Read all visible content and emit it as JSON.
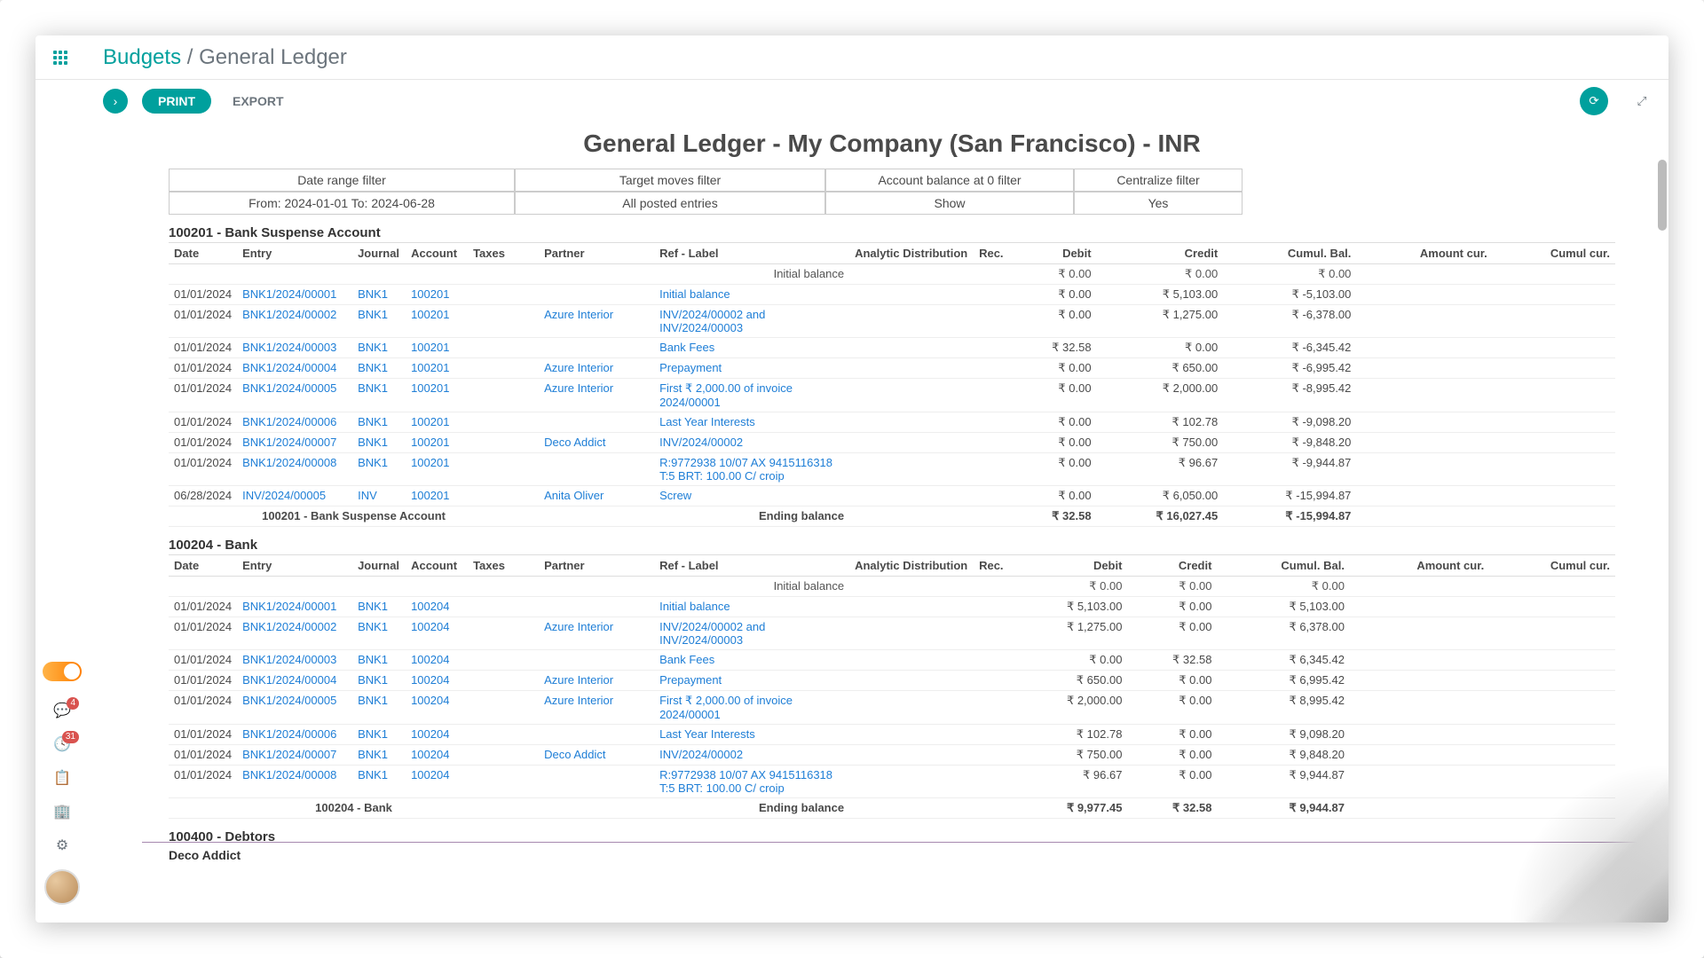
{
  "breadcrumb": {
    "parent": "Budgets",
    "sep": "/",
    "current": "General Ledger"
  },
  "toolbar": {
    "print": "PRINT",
    "export": "EXPORT"
  },
  "sidebar": {
    "badge1": "4",
    "badge2": "31"
  },
  "report_title": "General Ledger - My Company (San Francisco) - INR",
  "filters": {
    "h_date": "Date range filter",
    "h_moves": "Target moves filter",
    "h_balance": "Account balance at 0 filter",
    "h_central": "Centralize filter",
    "v_date": "From: 2024-01-01 To: 2024-06-28",
    "v_moves": "All posted entries",
    "v_balance": "Show",
    "v_central": "Yes"
  },
  "columns": {
    "date": "Date",
    "entry": "Entry",
    "journal": "Journal",
    "account": "Account",
    "taxes": "Taxes",
    "partner": "Partner",
    "ref": "Ref - Label",
    "analytic": "Analytic Distribution",
    "rec": "Rec.",
    "debit": "Debit",
    "credit": "Credit",
    "cumul": "Cumul. Bal.",
    "amt_cur": "Amount cur.",
    "cumul_cur": "Cumul cur."
  },
  "labels": {
    "initial_balance": "Initial balance",
    "ending_balance": "Ending balance"
  },
  "accounts": [
    {
      "title": "100201 - Bank Suspense Account",
      "ending_label": "100201 - Bank Suspense Account",
      "initial": {
        "debit": "₹ 0.00",
        "credit": "₹ 0.00",
        "cumul": "₹ 0.00"
      },
      "rows": [
        {
          "date": "01/01/2024",
          "entry": "BNK1/2024/00001",
          "journal": "BNK1",
          "account": "100201",
          "partner": "",
          "ref": "Initial balance",
          "debit": "₹ 0.00",
          "credit": "₹ 5,103.00",
          "cumul": "₹ -5,103.00"
        },
        {
          "date": "01/01/2024",
          "entry": "BNK1/2024/00002",
          "journal": "BNK1",
          "account": "100201",
          "partner": "Azure Interior",
          "ref": "INV/2024/00002 and INV/2024/00003",
          "debit": "₹ 0.00",
          "credit": "₹ 1,275.00",
          "cumul": "₹ -6,378.00"
        },
        {
          "date": "01/01/2024",
          "entry": "BNK1/2024/00003",
          "journal": "BNK1",
          "account": "100201",
          "partner": "",
          "ref": "Bank Fees",
          "debit": "₹ 32.58",
          "credit": "₹ 0.00",
          "cumul": "₹ -6,345.42"
        },
        {
          "date": "01/01/2024",
          "entry": "BNK1/2024/00004",
          "journal": "BNK1",
          "account": "100201",
          "partner": "Azure Interior",
          "ref": "Prepayment",
          "debit": "₹ 0.00",
          "credit": "₹ 650.00",
          "cumul": "₹ -6,995.42"
        },
        {
          "date": "01/01/2024",
          "entry": "BNK1/2024/00005",
          "journal": "BNK1",
          "account": "100201",
          "partner": "Azure Interior",
          "ref": "First ₹ 2,000.00 of invoice 2024/00001",
          "debit": "₹ 0.00",
          "credit": "₹ 2,000.00",
          "cumul": "₹ -8,995.42"
        },
        {
          "date": "01/01/2024",
          "entry": "BNK1/2024/00006",
          "journal": "BNK1",
          "account": "100201",
          "partner": "",
          "ref": "Last Year Interests",
          "debit": "₹ 0.00",
          "credit": "₹ 102.78",
          "cumul": "₹ -9,098.20"
        },
        {
          "date": "01/01/2024",
          "entry": "BNK1/2024/00007",
          "journal": "BNK1",
          "account": "100201",
          "partner": "Deco Addict",
          "ref": "INV/2024/00002",
          "debit": "₹ 0.00",
          "credit": "₹ 750.00",
          "cumul": "₹ -9,848.20"
        },
        {
          "date": "01/01/2024",
          "entry": "BNK1/2024/00008",
          "journal": "BNK1",
          "account": "100201",
          "partner": "",
          "ref": "R:9772938 10/07 AX 9415116318 T:5 BRT: 100.00 C/ croip",
          "debit": "₹ 0.00",
          "credit": "₹ 96.67",
          "cumul": "₹ -9,944.87"
        },
        {
          "date": "06/28/2024",
          "entry": "INV/2024/00005",
          "journal": "INV",
          "account": "100201",
          "partner": "Anita Oliver",
          "ref": "Screw",
          "debit": "₹ 0.00",
          "credit": "₹ 6,050.00",
          "cumul": "₹ -15,994.87"
        }
      ],
      "ending": {
        "debit": "₹ 32.58",
        "credit": "₹ 16,027.45",
        "cumul": "₹ -15,994.87"
      }
    },
    {
      "title": "100204 - Bank",
      "ending_label": "100204 - Bank",
      "initial": {
        "debit": "₹ 0.00",
        "credit": "₹ 0.00",
        "cumul": "₹ 0.00"
      },
      "rows": [
        {
          "date": "01/01/2024",
          "entry": "BNK1/2024/00001",
          "journal": "BNK1",
          "account": "100204",
          "partner": "",
          "ref": "Initial balance",
          "debit": "₹ 5,103.00",
          "credit": "₹ 0.00",
          "cumul": "₹ 5,103.00"
        },
        {
          "date": "01/01/2024",
          "entry": "BNK1/2024/00002",
          "journal": "BNK1",
          "account": "100204",
          "partner": "Azure Interior",
          "ref": "INV/2024/00002 and INV/2024/00003",
          "debit": "₹ 1,275.00",
          "credit": "₹ 0.00",
          "cumul": "₹ 6,378.00"
        },
        {
          "date": "01/01/2024",
          "entry": "BNK1/2024/00003",
          "journal": "BNK1",
          "account": "100204",
          "partner": "",
          "ref": "Bank Fees",
          "debit": "₹ 0.00",
          "credit": "₹ 32.58",
          "cumul": "₹ 6,345.42"
        },
        {
          "date": "01/01/2024",
          "entry": "BNK1/2024/00004",
          "journal": "BNK1",
          "account": "100204",
          "partner": "Azure Interior",
          "ref": "Prepayment",
          "debit": "₹ 650.00",
          "credit": "₹ 0.00",
          "cumul": "₹ 6,995.42"
        },
        {
          "date": "01/01/2024",
          "entry": "BNK1/2024/00005",
          "journal": "BNK1",
          "account": "100204",
          "partner": "Azure Interior",
          "ref": "First ₹ 2,000.00 of invoice 2024/00001",
          "debit": "₹ 2,000.00",
          "credit": "₹ 0.00",
          "cumul": "₹ 8,995.42"
        },
        {
          "date": "01/01/2024",
          "entry": "BNK1/2024/00006",
          "journal": "BNK1",
          "account": "100204",
          "partner": "",
          "ref": "Last Year Interests",
          "debit": "₹ 102.78",
          "credit": "₹ 0.00",
          "cumul": "₹ 9,098.20"
        },
        {
          "date": "01/01/2024",
          "entry": "BNK1/2024/00007",
          "journal": "BNK1",
          "account": "100204",
          "partner": "Deco Addict",
          "ref": "INV/2024/00002",
          "debit": "₹ 750.00",
          "credit": "₹ 0.00",
          "cumul": "₹ 9,848.20"
        },
        {
          "date": "01/01/2024",
          "entry": "BNK1/2024/00008",
          "journal": "BNK1",
          "account": "100204",
          "partner": "",
          "ref": "R:9772938 10/07 AX 9415116318 T:5 BRT: 100.00 C/ croip",
          "debit": "₹ 96.67",
          "credit": "₹ 0.00",
          "cumul": "₹ 9,944.87"
        }
      ],
      "ending": {
        "debit": "₹ 9,977.45",
        "credit": "₹ 32.58",
        "cumul": "₹ 9,944.87"
      }
    }
  ],
  "next_accounts": {
    "a": "100400 - Debtors",
    "b": "Deco Addict"
  }
}
